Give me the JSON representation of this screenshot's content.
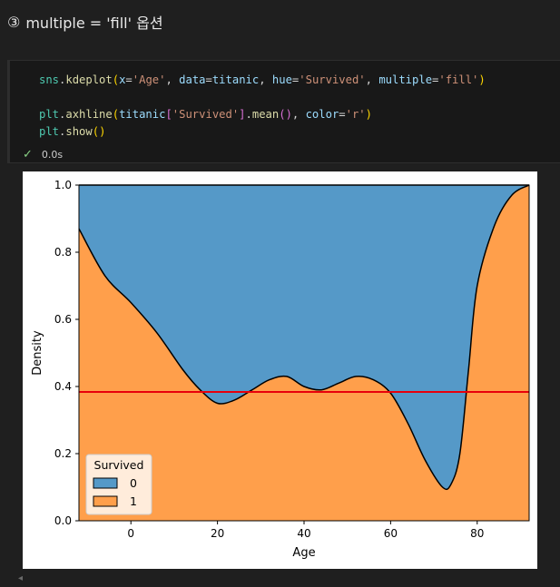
{
  "heading": {
    "circled_number": "③",
    "title": "multiple = 'fill' 옵션"
  },
  "code_cell": {
    "lines": [
      "sns.kdeplot(x='Age', data=titanic, hue='Survived', multiple='fill')",
      "",
      "plt.axhline(titanic['Survived'].mean(), color='r')",
      "plt.show()"
    ],
    "status_text": "0.0s"
  },
  "chart_data": {
    "type": "area",
    "stacked": "fill",
    "xlabel": "Age",
    "ylabel": "Density",
    "xlim": [
      -12,
      92
    ],
    "ylim": [
      0,
      1
    ],
    "xticks": [
      0,
      20,
      40,
      60,
      80
    ],
    "yticks": [
      0.0,
      0.2,
      0.4,
      0.6,
      0.8,
      1.0
    ],
    "ytick_labels": [
      "0.0",
      "0.2",
      "0.4",
      "0.6",
      "0.8",
      "1.0"
    ],
    "x": [
      -12,
      -6,
      0,
      6,
      12,
      16,
      20,
      24,
      28,
      32,
      36,
      40,
      44,
      48,
      52,
      56,
      60,
      64,
      68,
      72,
      74,
      76,
      78,
      80,
      84,
      88,
      92
    ],
    "series": [
      {
        "name": "0",
        "color": "#5599c8",
        "values": [
          0.13,
          0.27,
          0.35,
          0.44,
          0.55,
          0.61,
          0.65,
          0.64,
          0.61,
          0.58,
          0.57,
          0.6,
          0.61,
          0.59,
          0.57,
          0.58,
          0.62,
          0.71,
          0.82,
          0.9,
          0.89,
          0.8,
          0.55,
          0.3,
          0.12,
          0.03,
          0.0
        ]
      },
      {
        "name": "1",
        "color": "#ff9f4b",
        "values": [
          0.87,
          0.73,
          0.65,
          0.56,
          0.45,
          0.39,
          0.35,
          0.36,
          0.39,
          0.42,
          0.43,
          0.4,
          0.39,
          0.41,
          0.43,
          0.42,
          0.38,
          0.29,
          0.18,
          0.1,
          0.11,
          0.2,
          0.45,
          0.7,
          0.88,
          0.97,
          1.0
        ]
      }
    ],
    "hline": {
      "y": 0.3838,
      "color": "#e8000b"
    },
    "legend": {
      "title": "Survived",
      "placement": "lower-left",
      "entries": [
        "0",
        "1"
      ]
    }
  }
}
